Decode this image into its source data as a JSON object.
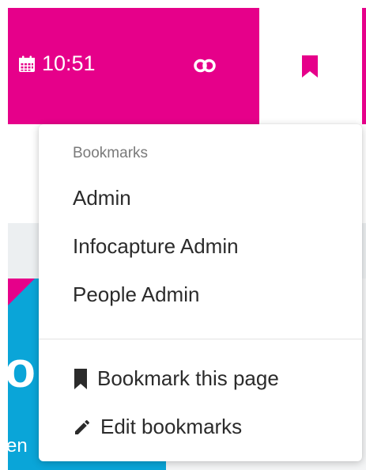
{
  "header": {
    "time": "10:51",
    "calendar_icon": "calendar-icon",
    "link_icon": "link-icon",
    "bookmark_icon": "bookmark-icon"
  },
  "background": {
    "tile_text_large": "o",
    "tile_text_small": "en"
  },
  "bookmarks_menu": {
    "heading": "Bookmarks",
    "items": [
      {
        "label": "Admin"
      },
      {
        "label": "Infocapture Admin"
      },
      {
        "label": "People Admin"
      }
    ],
    "actions": [
      {
        "label": "Bookmark this page",
        "icon": "bookmark-icon"
      },
      {
        "label": "Edit bookmarks",
        "icon": "pencil-icon"
      }
    ]
  },
  "colors": {
    "brand": "#e6008a",
    "tile": "#0aa5d8",
    "text": "#2b2b2b",
    "muted": "#7a7a7a"
  }
}
